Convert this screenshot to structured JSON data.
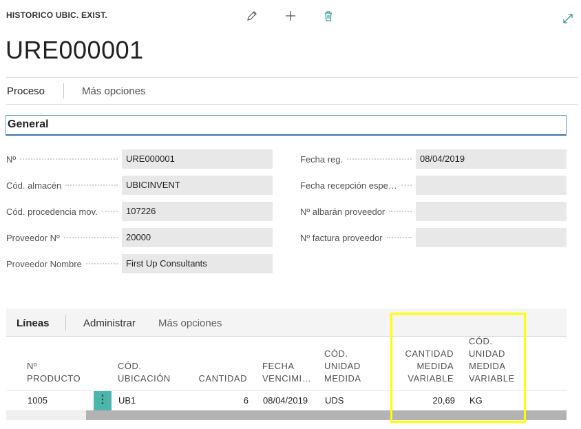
{
  "page": {
    "caption": "HISTORICO UBIC. EXIST.",
    "title": "URE000001"
  },
  "toolbar": {
    "edit_icon": "pencil-icon",
    "new_icon": "plus-icon",
    "delete_icon": "trash-icon",
    "expand_icon": "expand-icon"
  },
  "actions": {
    "primary": "Proceso",
    "more": "Más opciones"
  },
  "general": {
    "header": "General",
    "left_fields": [
      {
        "label": "Nº",
        "value": "URE000001"
      },
      {
        "label": "Cód. almacén",
        "value": "UBICINVENT"
      },
      {
        "label": "Cód. procedencia mov.",
        "value": "107226"
      },
      {
        "label": "Proveedor Nº",
        "value": "20000"
      },
      {
        "label": "Proveedor Nombre",
        "value": "First Up Consultants"
      }
    ],
    "right_fields": [
      {
        "label": "Fecha reg.",
        "value": "08/04/2019"
      },
      {
        "label": "Fecha recepción espe…",
        "value": ""
      },
      {
        "label": "Nº albarán proveedor",
        "value": ""
      },
      {
        "label": "Nº factura proveedor",
        "value": ""
      }
    ]
  },
  "lines": {
    "actions": {
      "lines": "Líneas",
      "manage": "Administrar",
      "more": "Más opciones"
    },
    "columns": [
      "Nº\nPRODUCTO",
      "CÓD.\nUBICACIÓN",
      "CANTIDAD",
      "FECHA\nVENCIMI…",
      "CÓD.\nUNIDAD\nMEDIDA",
      "CANTIDAD\nMEDIDA\nVARIABLE",
      "CÓD.\nUNIDAD\nMEDIDA\nVARIABLE"
    ],
    "rows": [
      {
        "producto": "1005",
        "ubicacion": "UB1",
        "cantidad": "6",
        "fecha": "08/04/2019",
        "unidad": "UDS",
        "cant_variable": "20,69",
        "unidad_variable": "KG"
      }
    ]
  },
  "colors": {
    "accent": "#5b9bd5",
    "row_menu": "#4db6ac",
    "highlight": "#ffff00"
  }
}
